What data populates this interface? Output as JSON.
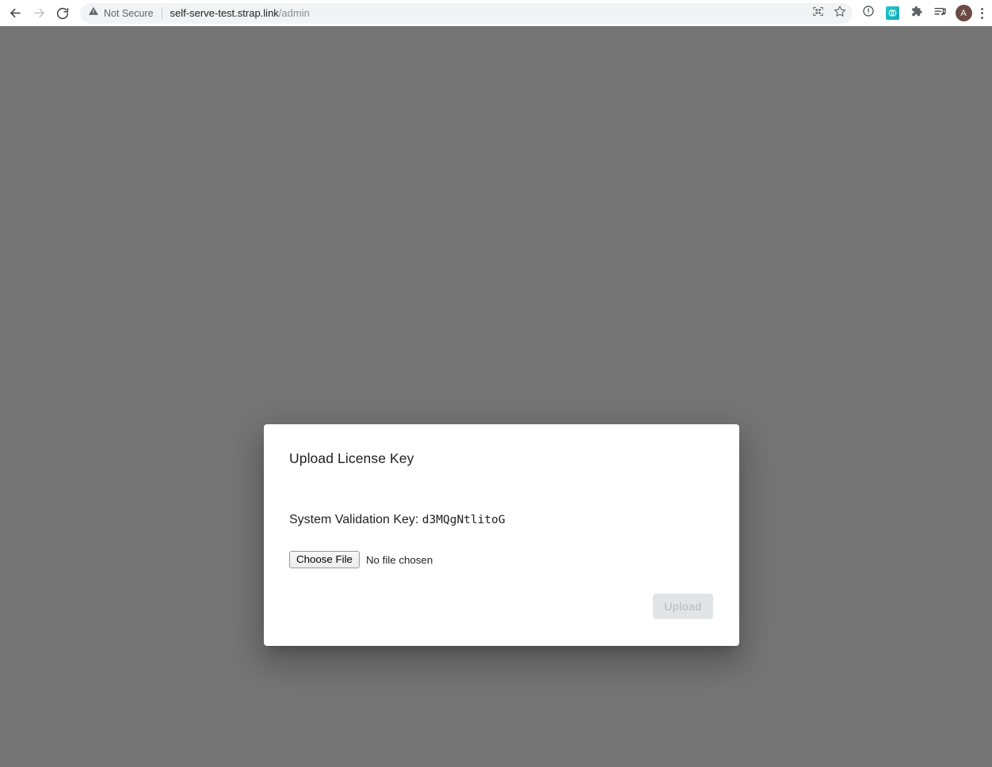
{
  "browser": {
    "back_icon": "back-arrow-icon",
    "forward_icon": "forward-arrow-icon",
    "reload_icon": "reload-icon",
    "security_label": "Not Secure",
    "security_icon": "warning-triangle-icon",
    "url_domain": "self-serve-test.strap.link",
    "url_path": "/admin",
    "qr_icon": "qr-code-icon",
    "bookmark_icon": "star-bookmark-icon",
    "info_icon": "info-circle-icon",
    "extension_icon": "chain-links-extension-icon",
    "puzzle_icon": "puzzle-extensions-icon",
    "readinglist_icon": "reading-list-media-icon",
    "avatar_label": "A",
    "menu_icon": "three-dot-menu-icon",
    "colors": {
      "omnibox_bg": "#f1f3f4",
      "extension_teal": "#17b3bb",
      "avatar_brown": "#6b4b43"
    }
  },
  "overlay": {
    "backdrop_color": "#757575"
  },
  "dialog": {
    "title": "Upload License Key",
    "validation_label": "System Validation Key:",
    "validation_key": "d3MQgNtlitoG",
    "choose_file_label": "Choose File",
    "no_file_label": "No file chosen",
    "upload_label": "Upload",
    "upload_disabled": true,
    "colors": {
      "surface": "#ffffff",
      "upload_bg": "#e2e4e7",
      "upload_text": "#b4b7bb"
    }
  }
}
